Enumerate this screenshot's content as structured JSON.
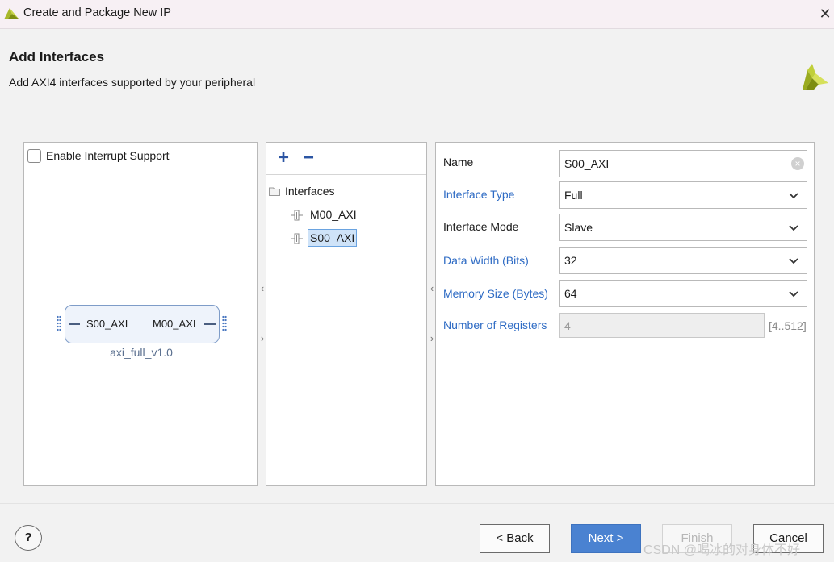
{
  "window": {
    "title": "Create and Package New IP",
    "close_glyph": "✕"
  },
  "header": {
    "title": "Add Interfaces",
    "subtitle": "Add AXI4 interfaces supported by your peripheral"
  },
  "left_panel": {
    "interrupt_checkbox_label": "Enable Interrupt Support",
    "interrupt_checked": false,
    "ip_block": {
      "left_port": "S00_AXI",
      "right_port": "M00_AXI",
      "name": "axi_full_v1.0"
    }
  },
  "middle_panel": {
    "add_glyph": "+",
    "remove_glyph": "−",
    "tree_root": "Interfaces",
    "items": [
      {
        "label": "M00_AXI",
        "selected": false
      },
      {
        "label": "S00_AXI",
        "selected": true
      }
    ]
  },
  "right_panel": {
    "fields": {
      "name": {
        "label": "Name",
        "value": "S00_AXI"
      },
      "interface_type": {
        "label": "Interface Type",
        "value": "Full"
      },
      "interface_mode": {
        "label": "Interface Mode",
        "value": "Slave"
      },
      "data_width": {
        "label": "Data Width (Bits)",
        "value": "32"
      },
      "memory_size": {
        "label": "Memory Size (Bytes)",
        "value": "64"
      },
      "num_registers": {
        "label": "Number of Registers",
        "value": "4",
        "range": "[4..512]"
      }
    }
  },
  "footer": {
    "help": "?",
    "back": "< Back",
    "next": "Next >",
    "finish": "Finish",
    "cancel": "Cancel",
    "watermark": "CSDN @喝冰的对身体不好"
  },
  "colors": {
    "accent": "#4a82d1",
    "link": "#2e6bc4",
    "logo": "#9aab1f"
  }
}
